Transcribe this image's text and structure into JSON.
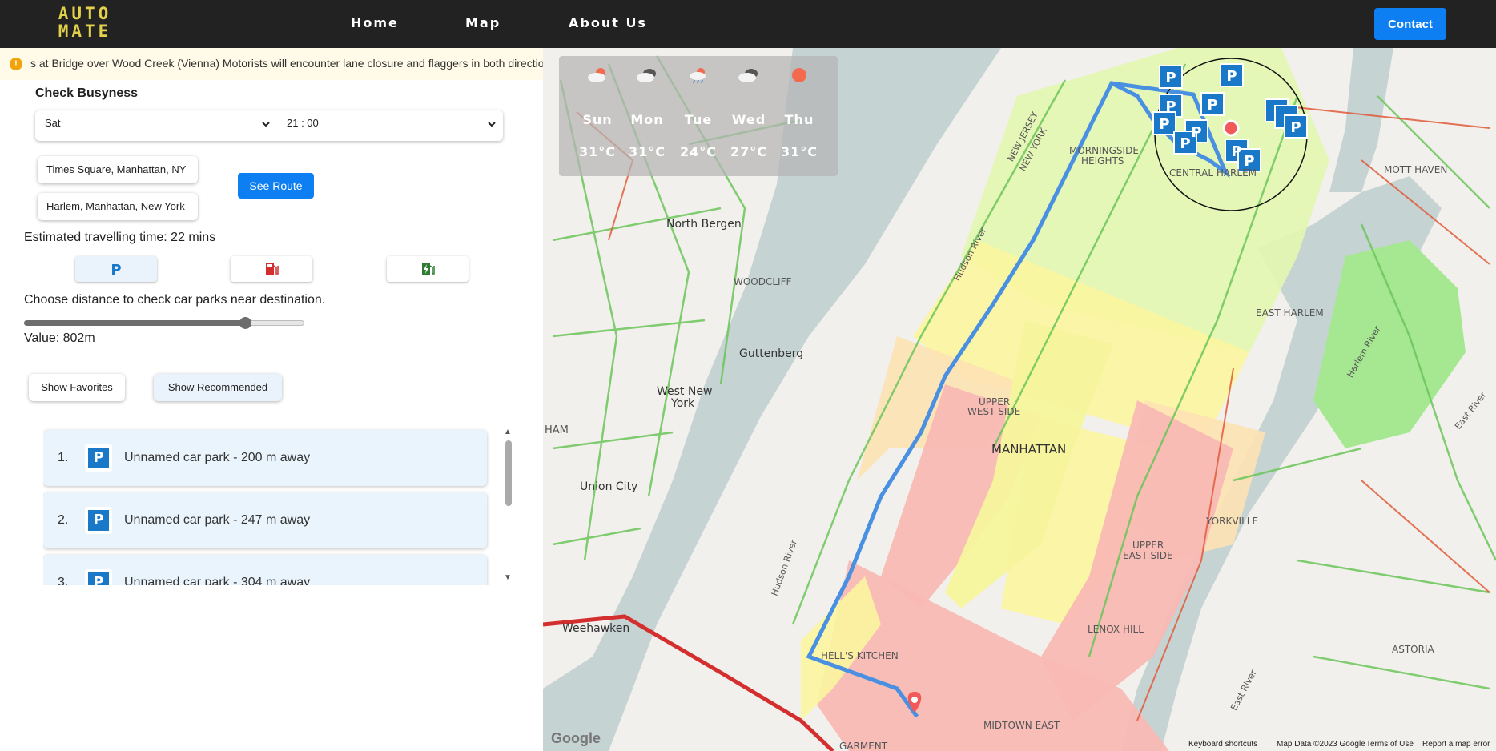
{
  "nav": {
    "logo_line1": "AUTO",
    "logo_line2": "MATE",
    "links": [
      "Home",
      "Map",
      "About Us"
    ],
    "contact": "Contact"
  },
  "ticker": {
    "icon": "!",
    "text": "s at Bridge over Wood Creek (Vienna) Motorists will encounter lane closure and flaggers in both directions"
  },
  "busyness": {
    "title": "Check Busyness",
    "day": "Sat",
    "time": "21 : 00"
  },
  "route": {
    "origin": "Times Square, Manhattan, NY",
    "destination": "Harlem, Manhattan, New York",
    "button": "See Route",
    "estimate": "Estimated travelling time: 22 mins"
  },
  "filters": {
    "parking_icon": "parking-icon",
    "fuel_icon": "fuel-pump-icon",
    "ev_icon": "ev-charger-icon"
  },
  "distance": {
    "prompt": "Choose distance to check car parks near destination.",
    "value_label": "Value: 802m",
    "slider_fraction": 0.79
  },
  "buttons": {
    "favorites": "Show Favorites",
    "recommended": "Show Recommended"
  },
  "carparks": [
    {
      "num": "1.",
      "label": "Unnamed car park - 200 m away"
    },
    {
      "num": "2.",
      "label": "Unnamed car park - 247 m away"
    },
    {
      "num": "3.",
      "label": "Unnamed car park - 304 m away"
    }
  ],
  "weather": [
    {
      "day": "Sun",
      "temp": "31°C",
      "icon": "cloud-sun-icon"
    },
    {
      "day": "Mon",
      "temp": "31°C",
      "icon": "cloud-dark-icon"
    },
    {
      "day": "Tue",
      "temp": "24°C",
      "icon": "cloud-rain-icon"
    },
    {
      "day": "Wed",
      "temp": "27°C",
      "icon": "cloud-dark-icon"
    },
    {
      "day": "Thu",
      "temp": "31°C",
      "icon": "sun-icon"
    }
  ],
  "map_labels": {
    "nj_ny_1": "NEW JERSEY",
    "nj_ny_2": "NEW YORK",
    "morningside_1": "MORNINGSIDE",
    "morningside_2": "HEIGHTS",
    "central_harlem": "CENTRAL HARLEM",
    "mott_haven": "MOTT HAVEN",
    "north_bergen": "North Bergen",
    "woodcliff": "WOODCLIFF",
    "hudson_river_1": "Hudson River",
    "east_harlem": "EAST HARLEM",
    "guttenberg": "Guttenberg",
    "west_new_york_1": "West New",
    "west_new_york_2": "York",
    "harlem_river": "Harlem River",
    "upper_west_1": "UPPER",
    "upper_west_2": "WEST SIDE",
    "ham": "HAM",
    "manhattan": "MANHATTAN",
    "east_river_1": "East River",
    "union_city": "Union City",
    "yorkville": "YORKVILLE",
    "upper_east_1": "UPPER",
    "upper_east_2": "EAST SIDE",
    "hudson_river_2": "Hudson River",
    "lenox_hill": "LENOX HILL",
    "weehawken": "Weehawken",
    "astoria": "ASTORIA",
    "hells_kitchen": "HELL'S KITCHEN",
    "east_river_2": "East River",
    "midtown_east": "MIDTOWN EAST",
    "garment": "GARMENT"
  },
  "map_footer": {
    "logo": "Google",
    "shortcuts": "Keyboard shortcuts",
    "data": "Map Data ©2023 Google",
    "terms": "Terms of Use",
    "report": "Report a map error"
  },
  "colors": {
    "accent": "#0d7ff2",
    "logo": "#e2d14a",
    "route": "#4a90e2",
    "marker": "#1978c8"
  }
}
